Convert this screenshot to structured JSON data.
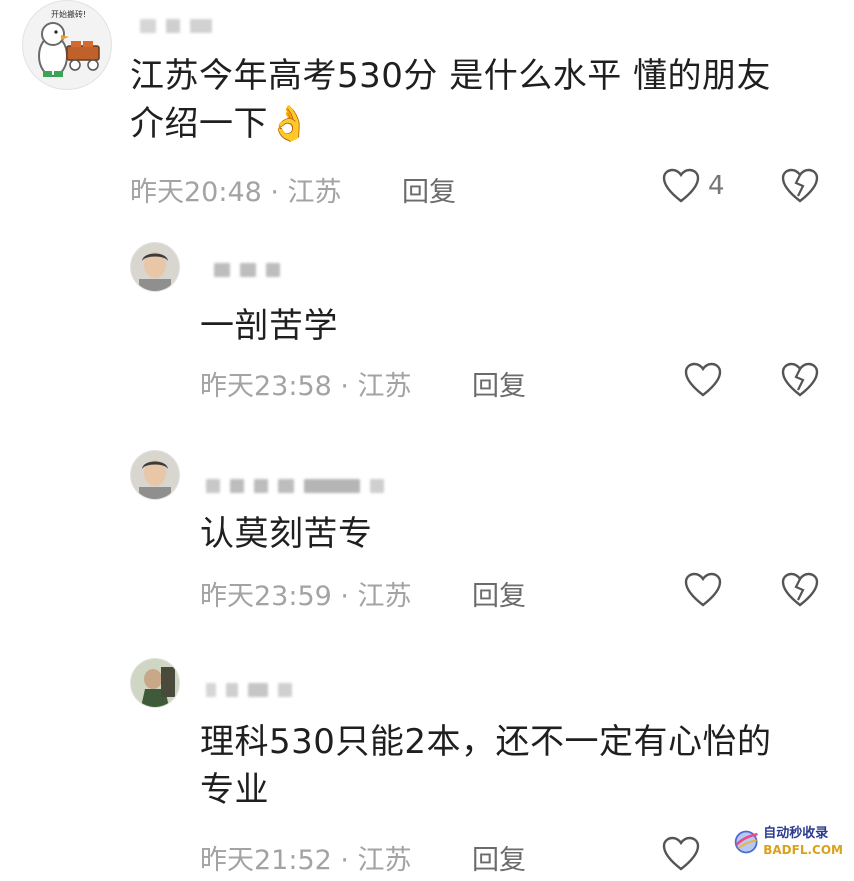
{
  "comments": [
    {
      "text_line1": "江苏今年高考530分 是什么水平 懂的朋友",
      "text_line2": "介绍一下",
      "emoji": "👌",
      "time": "昨天20:48 · 江苏",
      "reply": "回复",
      "likes": "4"
    },
    {
      "text_line1": "一剖苦学",
      "time": "昨天23:58 · 江苏",
      "reply": "回复"
    },
    {
      "text_line1": "认莫刻苦专",
      "time": "昨天23:59 · 江苏",
      "reply": "回复"
    },
    {
      "text_line1": "理科530只能2本，还不一定有心怡的",
      "text_line2": "专业",
      "time": "昨天21:52 · 江苏",
      "reply": "回复"
    }
  ],
  "main_avatar_caption": "开始搬砖!",
  "watermark": {
    "cn": "自动秒收录",
    "en": "BADFL.COM"
  },
  "colors": {
    "meta": "#a3a3a3",
    "text": "#1f1f1f",
    "icon": "#555555"
  }
}
